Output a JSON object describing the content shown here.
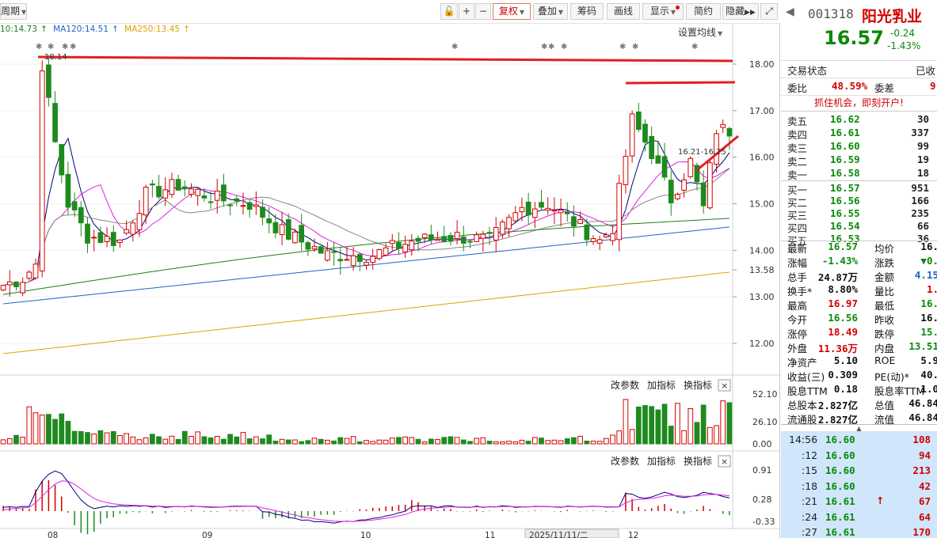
{
  "toolbar": {
    "period": "周期",
    "lock_icon": "lock-icon",
    "plus": "+",
    "minus": "−",
    "fuquan": "复权",
    "diejia": "叠加",
    "chouma": "筹码",
    "huaxian": "画线",
    "xianshi": "显示",
    "jianyue": "简约",
    "yincang": "隐藏",
    "expand_icon": "expand-icon"
  },
  "ma_bar": {
    "ma60": "10:14.73",
    "ma120": "MA120:14.51",
    "ma250": "MA250:13.45",
    "settings": "设置均线"
  },
  "price_axis": [
    "18.00",
    "17.00",
    "16.00",
    "15.00",
    "14.00",
    "13.58",
    "13.00",
    "12.00"
  ],
  "annotations": {
    "high_label": "18.14",
    "recent_label": "16.21-16.25"
  },
  "volume_panel": {
    "params": "改参数",
    "add": "加指标",
    "change": "换指标",
    "axis": [
      "52.10",
      "26.10",
      "0.00"
    ]
  },
  "macd_panel": {
    "params": "改参数",
    "add": "加指标",
    "change": "换指标",
    "axis": [
      "0.91",
      "0.28",
      "-0.33"
    ]
  },
  "x_axis": [
    "08",
    "09",
    "10",
    "11",
    "2025/11/11/二",
    "12"
  ],
  "stock": {
    "code": "001318",
    "name": "阳光乳业",
    "price": "16.57",
    "change": "-0.24",
    "change_pct": "-1.43%",
    "status_label": "交易状态",
    "status_value": "已收",
    "weibi_label": "委比",
    "weibi": "48.59%",
    "weicha_label": "委差",
    "weicha": "9",
    "promo": "抓住机会，即刻开户!"
  },
  "asks": [
    {
      "label": "卖五",
      "price": "16.62",
      "vol": "30"
    },
    {
      "label": "卖四",
      "price": "16.61",
      "vol": "337"
    },
    {
      "label": "卖三",
      "price": "16.60",
      "vol": "99"
    },
    {
      "label": "卖二",
      "price": "16.59",
      "vol": "19"
    },
    {
      "label": "卖一",
      "price": "16.58",
      "vol": "18"
    }
  ],
  "bids": [
    {
      "label": "买一",
      "price": "16.57",
      "vol": "951"
    },
    {
      "label": "买二",
      "price": "16.56",
      "vol": "166"
    },
    {
      "label": "买三",
      "price": "16.55",
      "vol": "235"
    },
    {
      "label": "买四",
      "price": "16.54",
      "vol": "66"
    },
    {
      "label": "买五",
      "price": "16.53",
      "vol": "36"
    }
  ],
  "stats": [
    {
      "l1": "最新",
      "v1": "16.57",
      "c1": "grn",
      "l2": "均价",
      "v2": "16.",
      "c2": "blk"
    },
    {
      "l1": "涨幅",
      "v1": "-1.43%",
      "c1": "grn",
      "l2": "涨跌",
      "v2": "▼0.",
      "c2": "grn"
    },
    {
      "l1": "总手",
      "v1": "24.87万",
      "c1": "blk",
      "l2": "金额",
      "v2": "4.15",
      "c2": "blu"
    },
    {
      "l1": "换手*",
      "v1": "8.80%",
      "c1": "blk",
      "l2": "量比",
      "v2": "1.",
      "c2": "red"
    },
    {
      "l1": "最高",
      "v1": "16.97",
      "c1": "red",
      "l2": "最低",
      "v2": "16.",
      "c2": "grn"
    },
    {
      "l1": "今开",
      "v1": "16.56",
      "c1": "grn",
      "l2": "昨收",
      "v2": "16.",
      "c2": "blk"
    },
    {
      "l1": "涨停",
      "v1": "18.49",
      "c1": "red",
      "l2": "跌停",
      "v2": "15.",
      "c2": "grn"
    },
    {
      "l1": "外盘",
      "v1": "11.36万",
      "c1": "red",
      "l2": "内盘",
      "v2": "13.51",
      "c2": "grn"
    },
    {
      "l1": "净资产",
      "v1": "5.10",
      "c1": "blk",
      "l2": "ROE",
      "v2": "5.9",
      "c2": "blk"
    },
    {
      "l1": "收益(三)",
      "v1": "0.309",
      "c1": "blk",
      "l2": "PE(动)*",
      "v2": "40.",
      "c2": "blk"
    },
    {
      "l1": "股息TTM",
      "v1": "0.18",
      "c1": "blk",
      "l2": "股息率TTM",
      "v2": "1.0",
      "c2": "blk"
    },
    {
      "l1": "总股本",
      "v1": "2.827亿",
      "c1": "blk",
      "l2": "总值",
      "v2": "46.84",
      "c2": "blk"
    },
    {
      "l1": "流通股",
      "v1": "2.827亿",
      "c1": "blk",
      "l2": "流值",
      "v2": "46.84",
      "c2": "blk"
    }
  ],
  "ticks": [
    {
      "time": "14:56",
      "price": "16.60",
      "vol": "108",
      "arrow": ""
    },
    {
      "time": ":12",
      "price": "16.60",
      "vol": "94",
      "arrow": ""
    },
    {
      "time": ":15",
      "price": "16.60",
      "vol": "213",
      "arrow": ""
    },
    {
      "time": ":18",
      "price": "16.60",
      "vol": "42",
      "arrow": ""
    },
    {
      "time": ":21",
      "price": "16.61",
      "vol": "67",
      "arrow": "↑"
    },
    {
      "time": ":24",
      "price": "16.61",
      "vol": "64",
      "arrow": ""
    },
    {
      "time": ":27",
      "price": "16.61",
      "vol": "170",
      "arrow": ""
    }
  ],
  "colors": {
    "up": "#d40000",
    "down": "#1e8a1e",
    "ma5": "#000080",
    "ma10": "#e020e0",
    "ma20": "#888888",
    "ma60": "#1d7d1d",
    "ma120": "#1e64c8",
    "ma250": "#e0a000"
  }
}
